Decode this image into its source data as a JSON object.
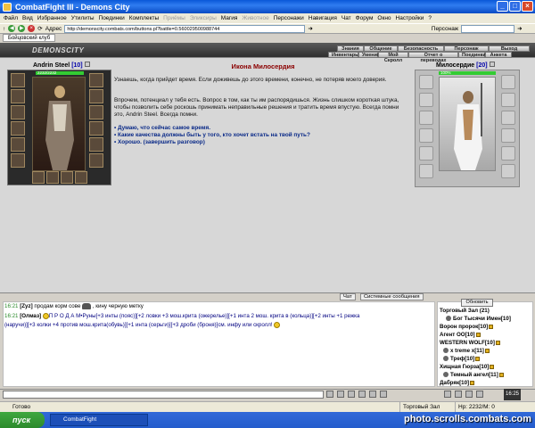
{
  "window": {
    "title": "CombatFight III - Demons City"
  },
  "menu": [
    "Файл",
    "Вид",
    "Избранное",
    "Утилиты",
    "Поединки",
    "Комплекты",
    "Приёмы",
    "Эликсиры",
    "Магия",
    "Животное",
    "Персонажи",
    "Навигация",
    "Чат",
    "Форум",
    "Окно",
    "Настройки",
    "?"
  ],
  "menu_disabled": [
    6,
    7,
    9
  ],
  "navbar": {
    "address_label": "Адрес",
    "address": "http://demonscity.combats.com/buttons.pl?battle=0.560029500988744",
    "search_label": "Персонаж"
  },
  "tab": {
    "label": "Бойцовский клуб"
  },
  "game": {
    "logo": "DEMONSCITY",
    "nav_top": [
      "Знания",
      "Общение",
      "Безопасность",
      "Персонаж",
      "Выход"
    ],
    "nav_bottom": [
      "Инвентарь",
      "Умения",
      "Мой Скролл",
      "Отчет о переводах",
      "Поединки",
      "Анкета"
    ]
  },
  "player": {
    "name": "Andrin Steel",
    "level": "[10]",
    "hp_text": "2232/2232"
  },
  "npc": {
    "name": "Милосердие",
    "level": "[20]",
    "hp_text": "100%"
  },
  "dialog": {
    "title": "Икона Милосердия",
    "para1": "Узнаешь, когда прийдет время. Если доживешь до этого времени, конечно, не потеряв моего доверия.",
    "para2": "Впрочем, потенциал у тебя есть. Вопрос в том, как ты им распорядишься. Жизнь слишком короткая штука, чтобы позволить себе роскошь принимать неправильные решения и тратить время впустую. Всегда помни это, Andrin Steel. Всегда помни.",
    "options": [
      "• Думаю, что сейчас самое время.",
      "• Какие качества должны быть у того, кто хочет встать на твой путь?",
      "• Хорошо. (завершить разговор)"
    ]
  },
  "chat": {
    "tabs": [
      "Чат",
      "Системные сообщения"
    ],
    "line1": {
      "time": "16:21",
      "nick": "[Zyz]",
      "text_a": " продам корм сове ",
      "text_b": " , кину черную метку"
    },
    "line2": {
      "time": "16:21",
      "nick": "[Олмаз]",
      "text": "П Р О Д А М•Руны[+3 инты (пояс)][+2 ловки +3 мош.крита (ожерелье)][+1 инта 2 мош. крита в (кольца)][+2 инты +1 режка"
    },
    "line3": {
      "text": "(наручи)][+3 колки +4 против мош.крита(обувь)][+1 инта (серьги)][+3 дроби (броня)]см. инфу или скролл! "
    }
  },
  "online": {
    "refresh": "Обновить",
    "room": "Торговый Зал (21)",
    "users": [
      {
        "name": "Бог Тысячи Имен",
        "level": "[10]"
      },
      {
        "name": "Ворон пророк",
        "level": "[10]"
      },
      {
        "name": "Агент ОО",
        "level": "[10]"
      },
      {
        "name": "WESTERN WOLF",
        "level": "[10]"
      },
      {
        "name": "x treme x",
        "level": "[11]"
      },
      {
        "name": "Треф",
        "level": "[10]"
      },
      {
        "name": "Хищная Гюрза",
        "level": "[10]"
      },
      {
        "name": "Темный ангел",
        "level": "[11]"
      },
      {
        "name": "Дабряк",
        "level": "[10]"
      }
    ]
  },
  "toolbar": {
    "clock": "16:25"
  },
  "status": {
    "left": "Готово",
    "room": "Торговый Зал",
    "hp": "Hp: 2232/M: 0"
  },
  "taskbar": {
    "start": "пуск",
    "window": "CombatFight",
    "watermark": "photo.scrolls.combats.com"
  }
}
